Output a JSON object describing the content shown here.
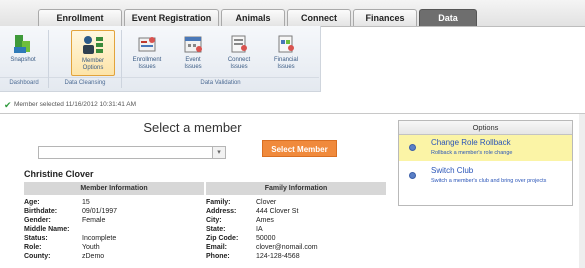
{
  "tabs": [
    {
      "label": "Enrollment",
      "active": false
    },
    {
      "label": "Event Registration",
      "active": false
    },
    {
      "label": "Animals",
      "active": false
    },
    {
      "label": "Connect",
      "active": false
    },
    {
      "label": "Finances",
      "active": false
    },
    {
      "label": "Data",
      "active": true
    }
  ],
  "ribbon": {
    "buttons": [
      {
        "line1": "Snapshot",
        "line2": "",
        "icon": "snapshot-icon"
      },
      {
        "line1": "Member",
        "line2": "Options",
        "icon": "member-options-icon"
      },
      {
        "line1": "Enrollment",
        "line2": "Issues",
        "icon": "enrollment-issues-icon"
      },
      {
        "line1": "Event",
        "line2": "Issues",
        "icon": "event-issues-icon"
      },
      {
        "line1": "Connect",
        "line2": "Issues",
        "icon": "connect-issues-icon"
      },
      {
        "line1": "Financial",
        "line2": "Issues",
        "icon": "financial-issues-icon"
      }
    ],
    "groups": [
      "Dashboard",
      "Data Cleansing",
      "Data Validation"
    ]
  },
  "status": {
    "text": "Member selected  11/16/2012 10:31:41 AM"
  },
  "select_member": {
    "title": "Select a member",
    "value": "",
    "button": "Select Member"
  },
  "member": {
    "name": "Christine Clover",
    "info_header": "Member Information",
    "family_header": "Family Information",
    "info": [
      {
        "label": "Age:",
        "value": "15"
      },
      {
        "label": "Birthdate:",
        "value": "09/01/1997"
      },
      {
        "label": "Gender:",
        "value": "Female"
      },
      {
        "label": "Middle Name:",
        "value": ""
      },
      {
        "label": "Status:",
        "value": "Incomplete"
      },
      {
        "label": "Role:",
        "value": "Youth"
      },
      {
        "label": "County:",
        "value": "zDemo"
      }
    ],
    "family": [
      {
        "label": "Family:",
        "value": "Clover"
      },
      {
        "label": "Address:",
        "value": "444 Clover St"
      },
      {
        "label": "City:",
        "value": "Ames"
      },
      {
        "label": "State:",
        "value": "IA"
      },
      {
        "label": "Zip Code:",
        "value": "50000"
      },
      {
        "label": "Email:",
        "value": "clover@nomail.com"
      },
      {
        "label": "Phone:",
        "value": "124-128-4568"
      }
    ]
  },
  "options": {
    "header": "Options",
    "items": [
      {
        "title": "Change Role Rollback",
        "desc": "Rollback a member's role change",
        "highlight": true
      },
      {
        "title": "Switch Club",
        "desc": "Switch a member's club and bring over projects",
        "highlight": false
      }
    ]
  }
}
